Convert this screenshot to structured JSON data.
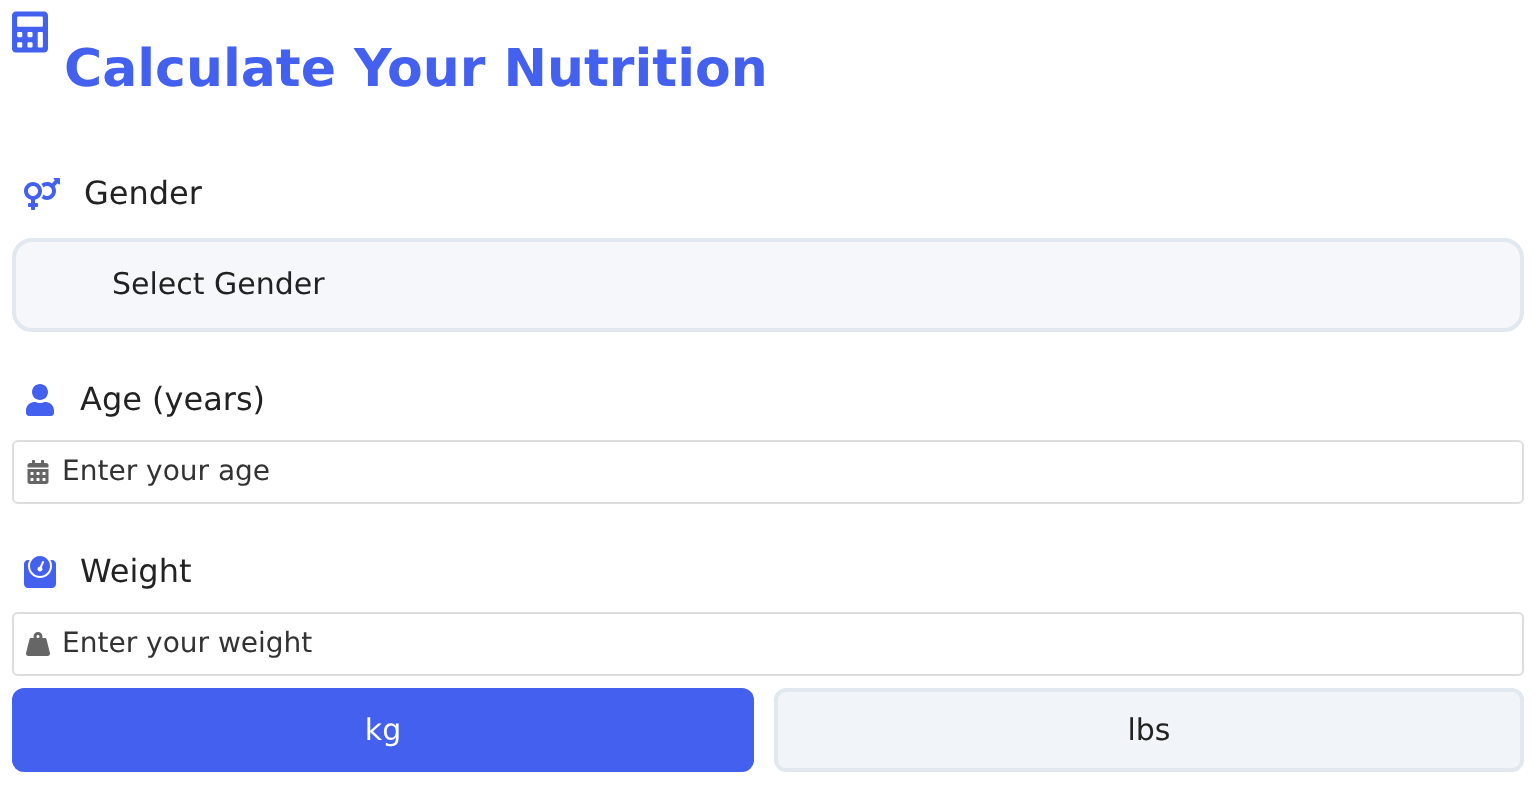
{
  "title": "Calculate Your Nutrition",
  "gender": {
    "label": "Gender",
    "value": "Select Gender"
  },
  "age": {
    "label": "Age (years)",
    "placeholder": "Enter your age"
  },
  "weight": {
    "label": "Weight",
    "placeholder": "Enter your weight"
  },
  "units": [
    {
      "label": "kg",
      "selected": true
    },
    {
      "label": "lbs",
      "selected": false
    }
  ]
}
